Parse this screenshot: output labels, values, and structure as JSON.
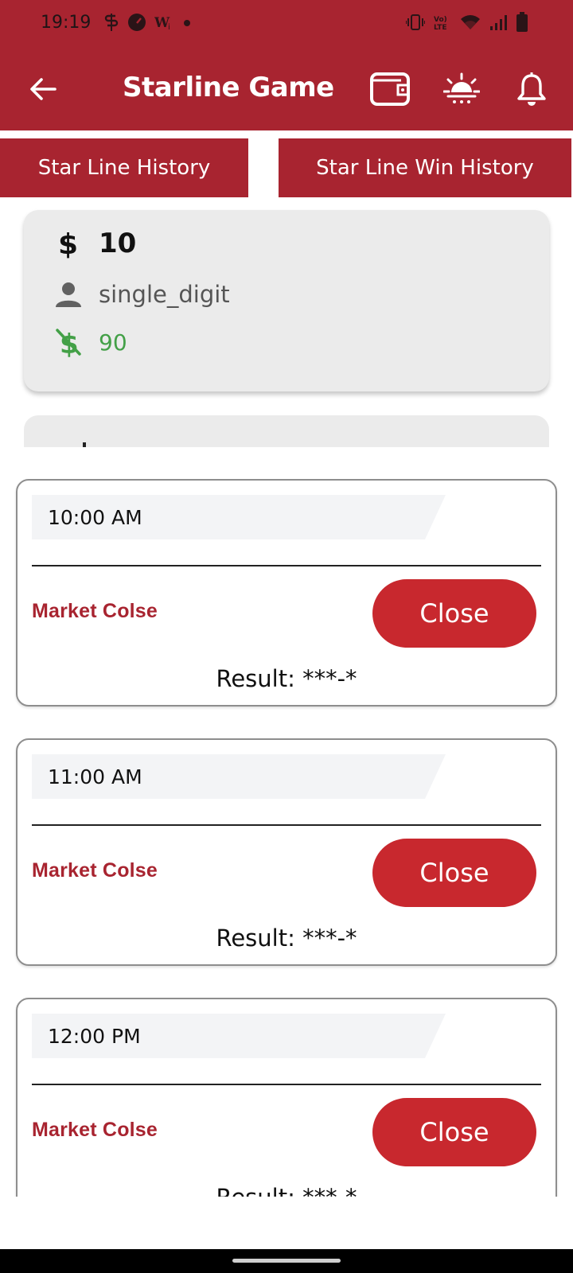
{
  "status_bar": {
    "time": "19:19",
    "left_icons": [
      "s-icon",
      "speedometer-icon",
      "w-icon",
      "dot-icon"
    ],
    "right_icons": [
      "vibrate-icon",
      "volte-icon",
      "wifi-icon",
      "signal-icon",
      "battery-icon"
    ]
  },
  "toolbar": {
    "title": "Starline Game",
    "icons": [
      "back-arrow-icon",
      "wallet-icon",
      "theme-icon",
      "bell-icon"
    ]
  },
  "tabs": [
    {
      "label": "Star Line History"
    },
    {
      "label": "Star Line Win History"
    }
  ],
  "summary": {
    "amount": "10",
    "game_type": "single_digit",
    "win_amount": "90"
  },
  "markets": [
    {
      "time": "10:00 AM",
      "status": "Market Colse",
      "button": "Close",
      "result": "Result: ***-*"
    },
    {
      "time": "11:00 AM",
      "status": "Market Colse",
      "button": "Close",
      "result": "Result: ***-*"
    },
    {
      "time": "12:00 PM",
      "status": "Market Colse",
      "button": "Close",
      "result": "Result: ***-*"
    }
  ],
  "colors": {
    "primary": "#a82430",
    "button_red": "#c8282e",
    "win_green": "#43a047",
    "card_grey": "#ebebeb"
  }
}
